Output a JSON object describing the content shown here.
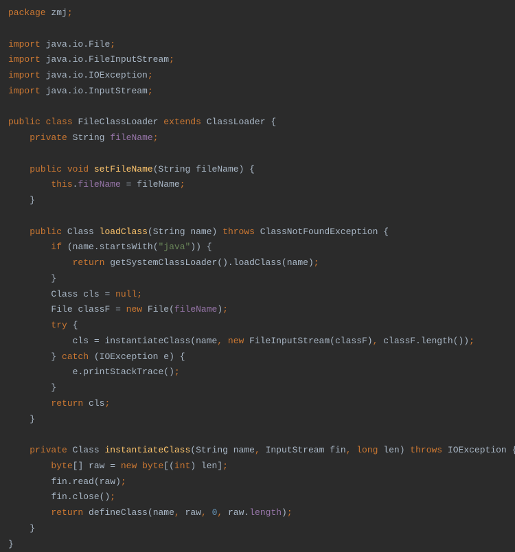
{
  "code": {
    "l1_package": "package",
    "l1_pkgname": "zmj",
    "l3_import": "import",
    "l3_path": "java.io.File",
    "l4_import": "import",
    "l4_path": "java.io.FileInputStream",
    "l5_import": "import",
    "l5_path": "java.io.IOException",
    "l6_import": "import",
    "l6_path": "java.io.InputStream",
    "l8_public": "public",
    "l8_class": "class",
    "l8_name": "FileClassLoader",
    "l8_extends": "extends",
    "l8_parent": "ClassLoader",
    "l9_private": "private",
    "l9_type": "String",
    "l9_field": "fileName",
    "l11_public": "public",
    "l11_void": "void",
    "l11_method": "setFileName",
    "l11_ptype": "String",
    "l11_pname": "fileName",
    "l12_this": "this",
    "l12_field": "fileName",
    "l12_param": "fileName",
    "l15_public": "public",
    "l15_ret": "Class",
    "l15_method": "loadClass",
    "l15_ptype": "String",
    "l15_pname": "name",
    "l15_throws": "throws",
    "l15_exc": "ClassNotFoundException",
    "l16_if": "if",
    "l16_var": "name",
    "l16_call": "startsWith",
    "l16_str": "\"java\"",
    "l17_return": "return",
    "l17_call1": "getSystemClassLoader",
    "l17_call2": "loadClass",
    "l17_arg": "name",
    "l19_type": "Class",
    "l19_var": "cls",
    "l19_null": "null",
    "l20_type": "File",
    "l20_var": "classF",
    "l20_new": "new",
    "l20_ctor": "File",
    "l20_arg": "fileName",
    "l21_try": "try",
    "l22_var": "cls",
    "l22_method": "instantiateClass",
    "l22_arg1": "name",
    "l22_new": "new",
    "l22_ctor": "FileInputStream",
    "l22_carg": "classF",
    "l22_obj": "classF",
    "l22_call": "length",
    "l23_catch": "catch",
    "l23_type": "IOException",
    "l23_var": "e",
    "l24_var": "e",
    "l24_call": "printStackTrace",
    "l26_return": "return",
    "l26_var": "cls",
    "l29_private": "private",
    "l29_ret": "Class",
    "l29_method": "instantiateClass",
    "l29_p1t": "String",
    "l29_p1n": "name",
    "l29_p2t": "InputStream",
    "l29_p2n": "fin",
    "l29_p3t": "long",
    "l29_p3n": "len",
    "l29_throws": "throws",
    "l29_exc": "IOException",
    "l30_type": "byte",
    "l30_var": "raw",
    "l30_new": "new",
    "l30_btype": "byte",
    "l30_cast": "int",
    "l30_arg": "len",
    "l31_var": "fin",
    "l31_call": "read",
    "l31_arg": "raw",
    "l32_var": "fin",
    "l32_call": "close",
    "l33_return": "return",
    "l33_call": "defineClass",
    "l33_a1": "name",
    "l33_a2": "raw",
    "l33_a3": "0",
    "l33_a4": "raw",
    "l33_a4f": "length"
  }
}
